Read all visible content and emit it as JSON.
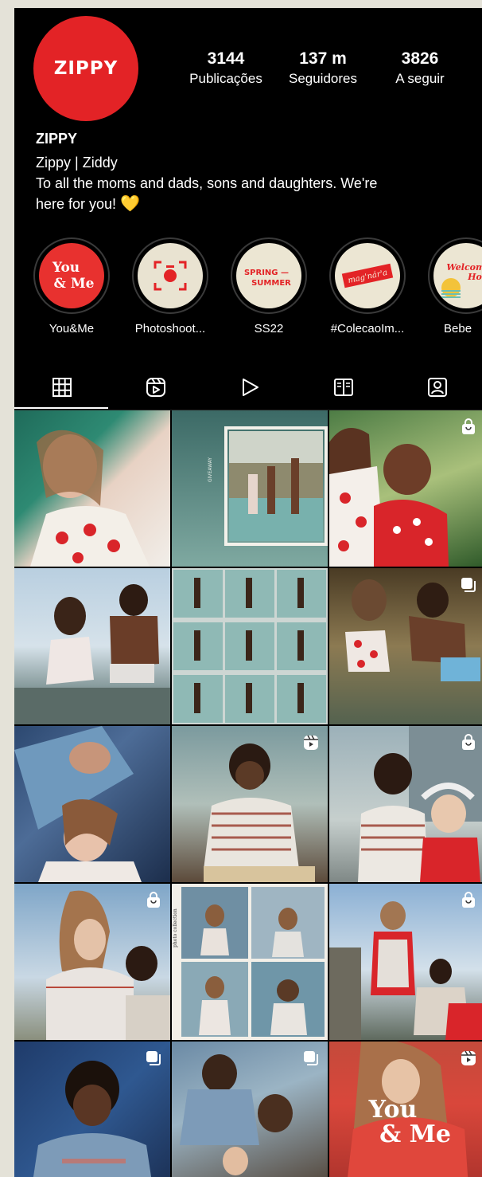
{
  "profile": {
    "avatar_text": "ZIPPY",
    "username": "ZIPPY",
    "name_line": "Zippy | Ziddy",
    "bio_line1": "To all the moms and dads, sons and daughters. We're",
    "bio_line2": "here for you!",
    "bio_emoji": "💛",
    "brand_color": "#e32326"
  },
  "stats": [
    {
      "value": "3144",
      "label": "Publicações"
    },
    {
      "value": "137 m",
      "label": "Seguidores"
    },
    {
      "value": "3826",
      "label": "A seguir"
    }
  ],
  "highlights": [
    {
      "label": "You&Me",
      "cover_text": "You & Me"
    },
    {
      "label": "Photoshoot...",
      "cover_icon": "camera-frame-icon"
    },
    {
      "label": "SS22",
      "cover_text": "SPRING — SUMMER"
    },
    {
      "label": "#ColecaoIm...",
      "cover_text": "mag'nár'a"
    },
    {
      "label": "Bebe",
      "cover_text": "Welcome Hon"
    }
  ],
  "tabs": [
    {
      "name": "grid-tab",
      "icon": "grid-icon",
      "active": true
    },
    {
      "name": "reels-tab",
      "icon": "reels-icon"
    },
    {
      "name": "video-tab",
      "icon": "play-icon"
    },
    {
      "name": "guides-tab",
      "icon": "guide-book-icon"
    },
    {
      "name": "tagged-tab",
      "icon": "tagged-person-icon"
    }
  ],
  "posts": [
    {
      "badge": "none"
    },
    {
      "badge": "none",
      "overlay_text": "GIVEAWAY"
    },
    {
      "badge": "shopping-bag-icon"
    },
    {
      "badge": "none"
    },
    {
      "badge": "none"
    },
    {
      "badge": "carousel-icon"
    },
    {
      "badge": "none"
    },
    {
      "badge": "reels-icon"
    },
    {
      "badge": "shopping-bag-icon"
    },
    {
      "badge": "shopping-bag-icon"
    },
    {
      "badge": "none"
    },
    {
      "badge": "shopping-bag-icon"
    },
    {
      "badge": "carousel-icon"
    },
    {
      "badge": "carousel-icon"
    },
    {
      "badge": "reels-icon",
      "overlay_text": "You & Me"
    }
  ]
}
